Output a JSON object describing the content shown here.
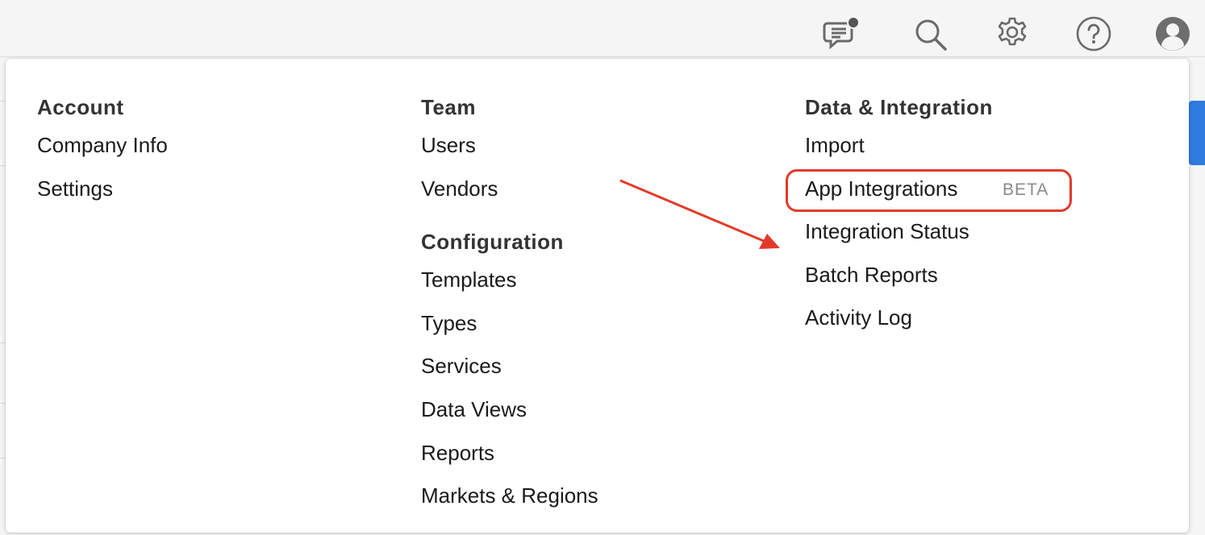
{
  "topbar": {
    "icons": [
      "chat-notification-icon",
      "search-icon",
      "gear-icon",
      "help-icon",
      "user-avatar-icon"
    ],
    "notification_color": "#555555"
  },
  "menu": {
    "account": {
      "heading": "Account",
      "items": [
        "Company Info",
        "Settings"
      ]
    },
    "team": {
      "heading": "Team",
      "items": [
        "Users",
        "Vendors"
      ]
    },
    "configuration": {
      "heading": "Configuration",
      "items": [
        "Templates",
        "Types",
        "Services",
        "Data Views",
        "Reports",
        "Markets & Regions"
      ]
    },
    "data_integration": {
      "heading": "Data & Integration",
      "items": [
        "Import",
        "App Integrations",
        "Integration Status",
        "Batch Reports",
        "Activity Log"
      ],
      "badge": "BETA"
    }
  },
  "annotation": {
    "color": "#e23a2a"
  }
}
